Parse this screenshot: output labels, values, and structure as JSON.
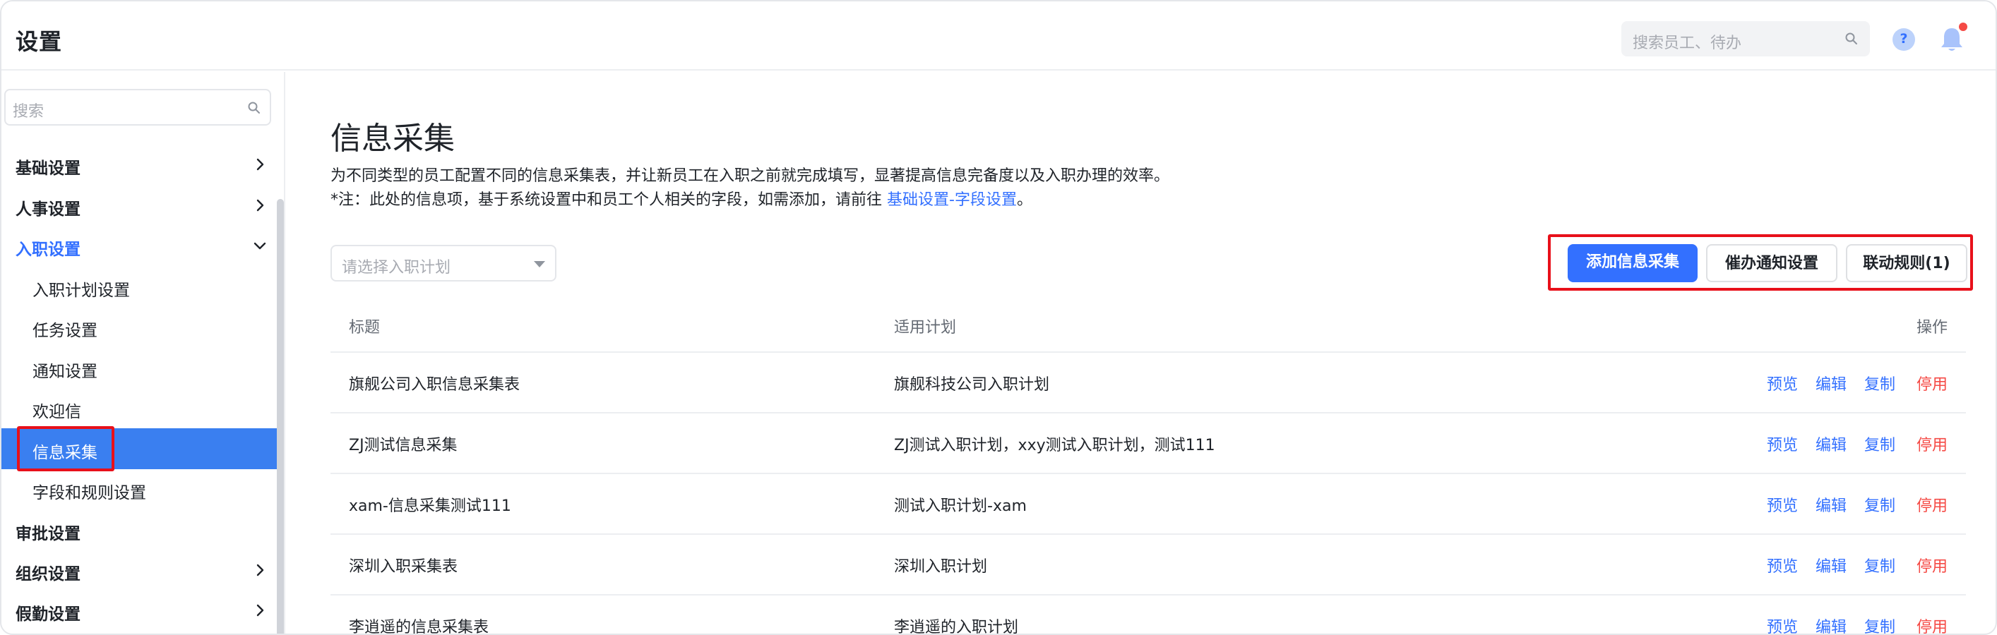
{
  "header": {
    "title": "设置",
    "search_placeholder": "搜索员工、待办",
    "help_label": "?"
  },
  "sidebar": {
    "search_placeholder": "搜索",
    "items": [
      {
        "label": "基础设置",
        "level": 1,
        "chevron": "right"
      },
      {
        "label": "人事设置",
        "level": 1,
        "chevron": "right"
      },
      {
        "label": "入职设置",
        "level": 1,
        "chevron": "down",
        "open": true
      },
      {
        "label": "入职计划设置",
        "level": 2
      },
      {
        "label": "任务设置",
        "level": 2
      },
      {
        "label": "通知设置",
        "level": 2
      },
      {
        "label": "欢迎信",
        "level": 2
      },
      {
        "label": "信息采集",
        "level": 2,
        "active": true
      },
      {
        "label": "字段和规则设置",
        "level": 2
      },
      {
        "label": "审批设置",
        "level": 1
      },
      {
        "label": "组织设置",
        "level": 1,
        "chevron": "right"
      },
      {
        "label": "假勤设置",
        "level": 1,
        "chevron": "right"
      }
    ]
  },
  "main": {
    "title": "信息采集",
    "description": "为不同类型的员工配置不同的信息采集表，并让新员工在入职之前就完成填写，显著提高信息完备度以及入职办理的效率。",
    "note_prefix": "*注：此处的信息项，基于系统设置中和员工个人相关的字段，如需添加，请前往 ",
    "note_link": "基础设置-字段设置",
    "note_suffix": "。",
    "plan_select_placeholder": "请选择入职计划",
    "buttons": {
      "add": "添加信息采集",
      "notify": "催办通知设置",
      "rules": "联动规则(1)"
    },
    "table": {
      "headers": {
        "title": "标题",
        "plan": "适用计划",
        "actions": "操作"
      },
      "action_labels": {
        "preview": "预览",
        "edit": "编辑",
        "copy": "复制",
        "disable": "停用"
      },
      "rows": [
        {
          "title": "旗舰公司入职信息采集表",
          "plan": "旗舰科技公司入职计划"
        },
        {
          "title": "ZJ测试信息采集",
          "plan": "ZJ测试入职计划，xxy测试入职计划，测试111"
        },
        {
          "title": "xam-信息采集测试111",
          "plan": "测试入职计划-xam"
        },
        {
          "title": "深圳入职采集表",
          "plan": "深圳入职计划"
        },
        {
          "title": "李逍遥的信息采集表",
          "plan": "李逍遥的入职计划"
        }
      ]
    }
  },
  "colors": {
    "accent": "#3370ff",
    "active_nav_bg": "#3a7ff0",
    "danger": "#f54a45",
    "highlight_box": "#e8101a"
  },
  "icons": {
    "header_search": "search-icon",
    "help": "question-circle-icon",
    "bell": "bell-icon",
    "sidebar_search": "search-icon",
    "chevron_right": "chevron-right-icon",
    "chevron_down": "chevron-down-icon",
    "select_caret": "caret-down-icon"
  }
}
